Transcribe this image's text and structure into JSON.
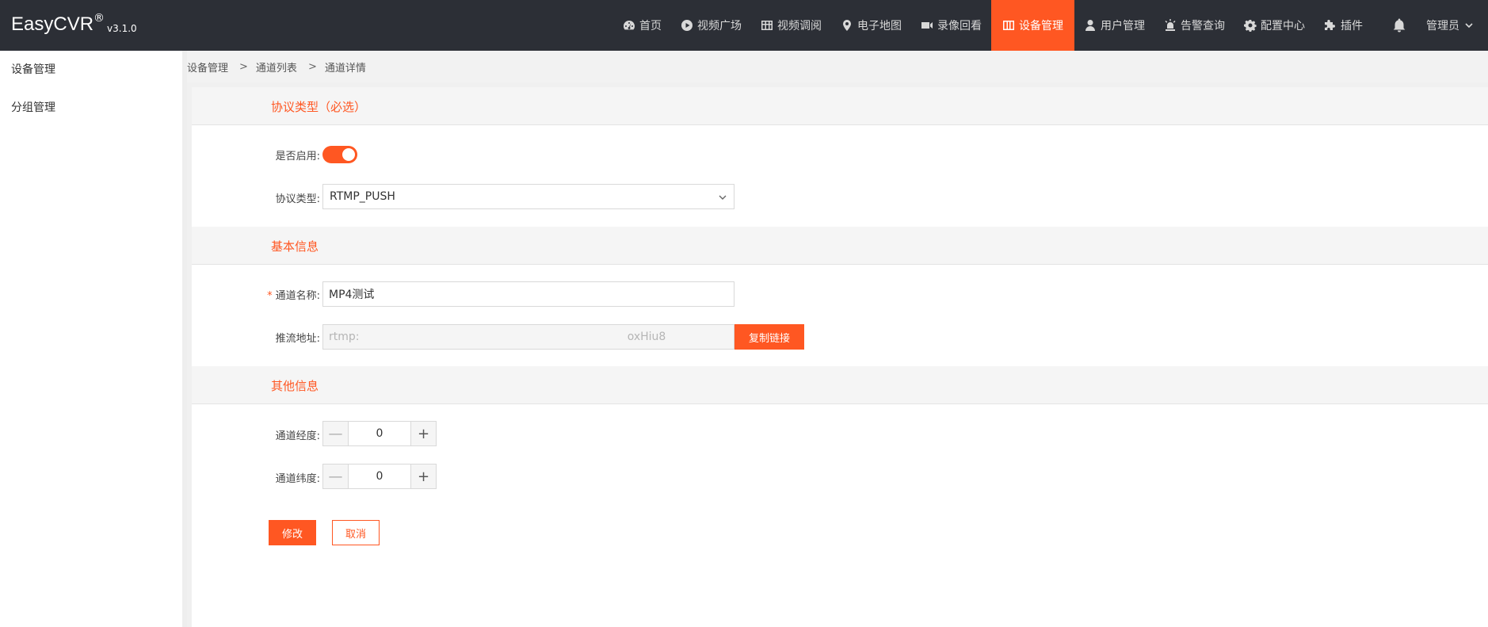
{
  "app": {
    "name": "EasyCVR",
    "reg": "®",
    "version": "v3.1.0"
  },
  "nav": [
    {
      "label": "首页",
      "icon": "dashboard-icon"
    },
    {
      "label": "视频广场",
      "icon": "play-circle-icon"
    },
    {
      "label": "视频调阅",
      "icon": "grid-icon"
    },
    {
      "label": "电子地图",
      "icon": "map-pin-icon"
    },
    {
      "label": "录像回看",
      "icon": "video-camera-icon"
    },
    {
      "label": "设备管理",
      "icon": "device-icon",
      "active": true
    },
    {
      "label": "用户管理",
      "icon": "user-icon"
    },
    {
      "label": "告警查询",
      "icon": "alarm-icon"
    },
    {
      "label": "配置中心",
      "icon": "gear-icon"
    },
    {
      "label": "插件",
      "icon": "puzzle-icon"
    }
  ],
  "user": {
    "label": "管理员"
  },
  "sidebar": {
    "items": [
      {
        "label": "设备管理"
      },
      {
        "label": "分组管理"
      }
    ]
  },
  "breadcrumb": [
    "设备管理",
    "通道列表",
    "通道详情"
  ],
  "breadcrumb_sep": ">",
  "sections": {
    "protocol": {
      "title": "协议类型（必选）"
    },
    "basic": {
      "title": "基本信息"
    },
    "other": {
      "title": "其他信息"
    }
  },
  "form": {
    "enable_label": "是否启用:",
    "enable_value": true,
    "protocol_label": "协议类型:",
    "protocol_value": "RTMP_PUSH",
    "required_mark": "*",
    "channel_name_label": "通道名称:",
    "channel_name_value": "MP4测试",
    "push_url_label": "推流地址:",
    "push_url_value": "rtmp:                                                                            oxHiu8",
    "copy_button": "复制链接",
    "longitude_label": "通道经度:",
    "longitude_value": "0",
    "latitude_label": "通道纬度:",
    "latitude_value": "0",
    "minus": "—",
    "plus": "+"
  },
  "actions": {
    "save": "修改",
    "cancel": "取消"
  },
  "colors": {
    "accent": "#ff5722",
    "topbar": "#2c2f36"
  }
}
